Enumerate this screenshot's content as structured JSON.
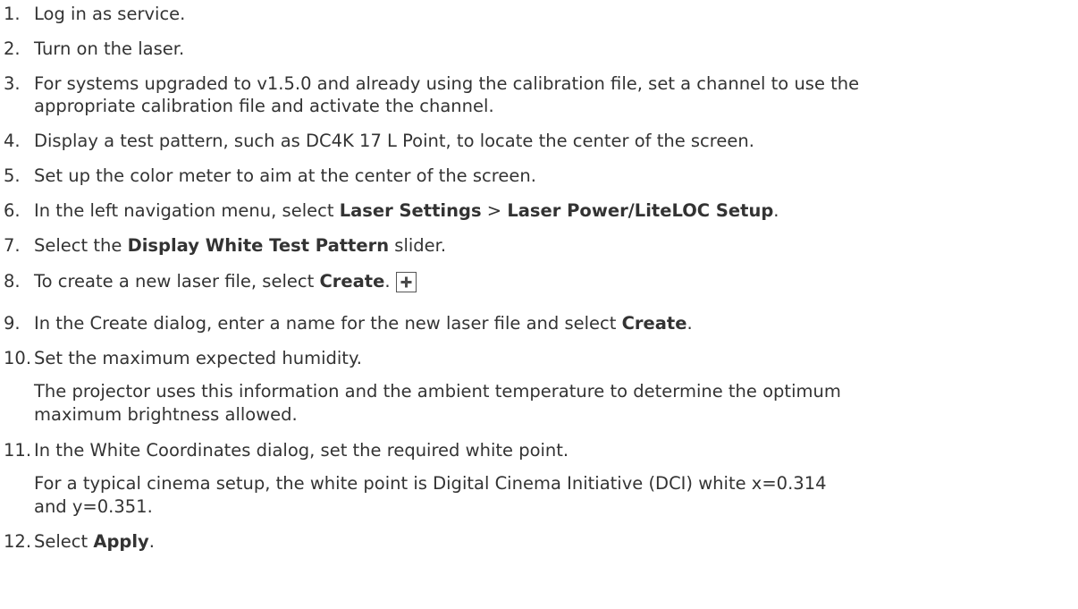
{
  "steps": [
    {
      "num": "1.",
      "text": "Log in as service."
    },
    {
      "num": "2.",
      "text": "Turn on the laser."
    },
    {
      "num": "3.",
      "line1": "For systems upgraded to v1.5.0 and already using the calibration file, set a channel to use the",
      "line2": "appropriate calibration file and activate the channel."
    },
    {
      "num": "4.",
      "text": "Display a test pattern, such as DC4K 17 L Point, to locate the center of the screen."
    },
    {
      "num": "5.",
      "text": "Set up the color meter to aim at the center of the screen."
    },
    {
      "num": "6.",
      "pre": "In the left navigation menu, select ",
      "bold1": "Laser Settings",
      "mid": " > ",
      "bold2": "Laser Power/LiteLOC Setup",
      "post": "."
    },
    {
      "num": "7.",
      "pre": "Select the ",
      "bold": "Display White Test Pattern",
      "post": " slider."
    },
    {
      "num": "8.",
      "pre": "To create a new laser file, select ",
      "bold": "Create",
      "post": ".",
      "icon": "plus-square-icon"
    },
    {
      "num": "9.",
      "pre": "In the Create dialog, enter a name for the new laser file and select ",
      "bold": "Create",
      "post": "."
    },
    {
      "num": "10.",
      "text": "Set the maximum expected humidity.",
      "sub1": "The projector uses this information and the ambient temperature to determine the optimum",
      "sub2": "maximum brightness allowed."
    },
    {
      "num": "11.",
      "text": "In the White Coordinates dialog, set the required white point.",
      "sub1": "For a typical cinema setup, the white point is Digital Cinema Initiative (DCI) white x=0.314",
      "sub2": "and y=0.351."
    },
    {
      "num": "12.",
      "pre": "Select ",
      "bold": "Apply",
      "post": "."
    }
  ]
}
